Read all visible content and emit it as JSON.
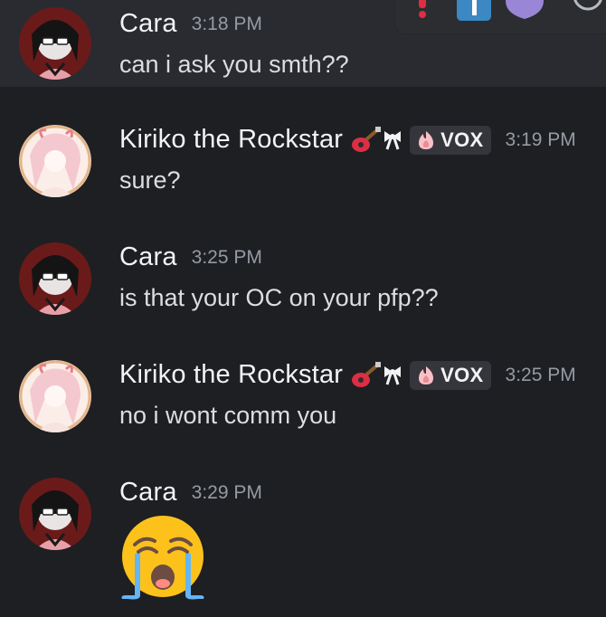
{
  "messages": [
    {
      "username": "Cara",
      "time": "3:18 PM",
      "text": "can i ask you smth??"
    },
    {
      "username": "Kiriko the Rockstar",
      "time": "3:19 PM",
      "text": "sure?",
      "tag": "VOX"
    },
    {
      "username": "Cara",
      "time": "3:25 PM",
      "text": "is that your OC on your pfp??"
    },
    {
      "username": "Kiriko the Rockstar",
      "time": "3:25 PM",
      "text": "no i wont comm you",
      "tag": "VOX"
    },
    {
      "username": "Cara",
      "time": "3:29 PM",
      "emoji": "loudly-crying-face"
    }
  ],
  "toolbar": {
    "icons": [
      "exclamation-reaction-icon",
      "blue-square-reaction-icon",
      "heart-shield-reaction-icon",
      "add-reaction-icon"
    ]
  },
  "colors": {
    "background": "#1e1f22",
    "hover_background": "#2a2b30",
    "timestamp": "#949ba4",
    "tag_background": "#35363c"
  }
}
